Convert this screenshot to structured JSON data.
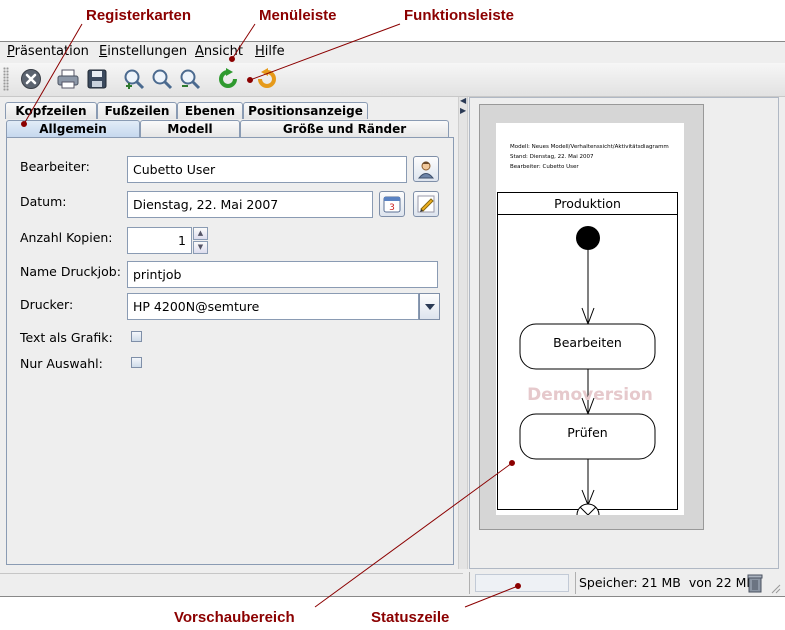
{
  "annotations": {
    "registerkarten": "Registerkarten",
    "menueleiste": "Menüleiste",
    "funktionsleiste": "Funktionsleiste",
    "vorschaubereich": "Vorschaubereich",
    "statuszeile": "Statuszeile"
  },
  "menu": {
    "items": [
      {
        "accel": "P",
        "rest": "räsentation"
      },
      {
        "accel": "E",
        "rest": "instellungen"
      },
      {
        "accel": "A",
        "rest": "nsicht"
      },
      {
        "accel": "H",
        "rest": "ilfe"
      }
    ]
  },
  "toolbar": {
    "icons": [
      "close-icon",
      "print-icon",
      "save-icon",
      "zoom-in-icon",
      "zoom-reset-icon",
      "zoom-out-icon",
      "refresh-icon",
      "undo-icon"
    ]
  },
  "tabs": {
    "row1": [
      "Kopfzeilen",
      "Fußzeilen",
      "Ebenen",
      "Positionsanzeige"
    ],
    "row2": [
      "Allgemein",
      "Modell",
      "Größe und Ränder"
    ],
    "active": "Allgemein"
  },
  "form": {
    "bearbeiter_label": "Bearbeiter:",
    "bearbeiter_value": "Cubetto User",
    "datum_label": "Datum:",
    "datum_value": "Dienstag, 22. Mai 2007",
    "kopien_label": "Anzahl Kopien:",
    "kopien_value": "1",
    "druckjob_label": "Name Druckjob:",
    "druckjob_value": "printjob",
    "drucker_label": "Drucker:",
    "drucker_value": "HP 4200N@semture",
    "grafik_label": "Text als Grafik:",
    "auswahl_label": "Nur Auswahl:",
    "calendar_day": "3"
  },
  "preview": {
    "header_line1": "Modell: Neues Modell/Verhaltenssicht/Aktivitätsdiagramm",
    "header_line2": "Stand: Dienstag, 22. Mai 2007",
    "header_line3": "Bearbeiter: Cubetto User",
    "swimlane_title": "Produktion",
    "activity1": "Bearbeiten",
    "activity2": "Prüfen",
    "watermark": "Demoversion"
  },
  "status": {
    "memory_label": "Speicher: 21 MB",
    "memory_of": "von 22 MB"
  },
  "colors": {
    "annotation": "#8b0000",
    "tab_active": "#c6d8ee",
    "border": "#8a9bb3"
  }
}
